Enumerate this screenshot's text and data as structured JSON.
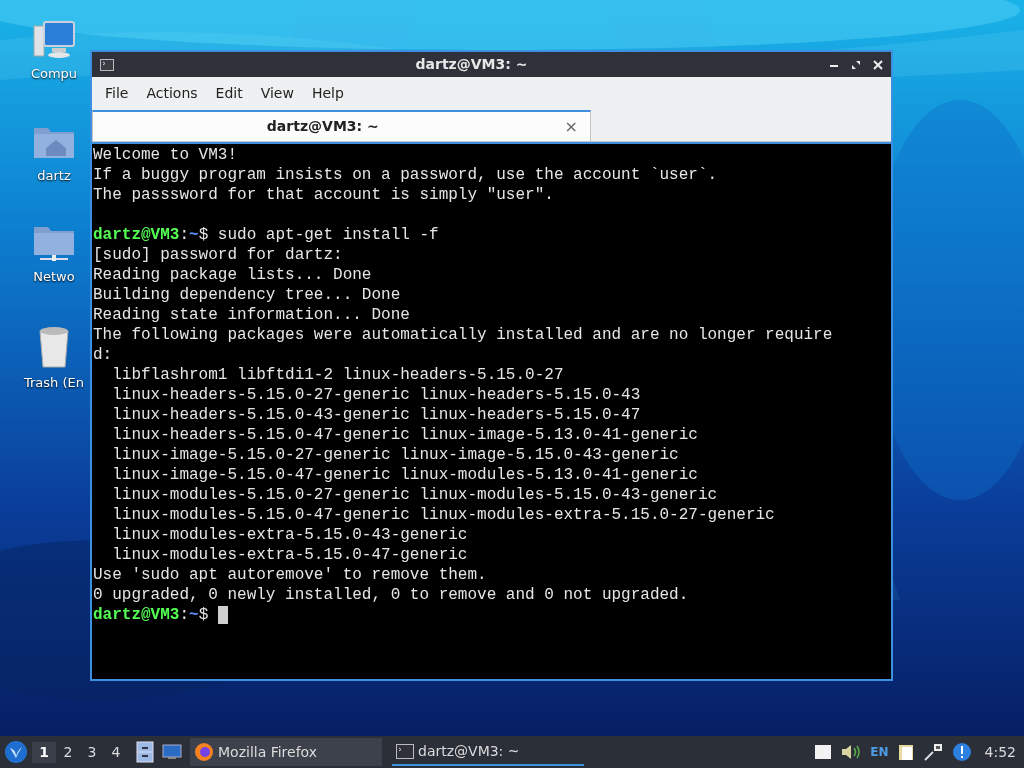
{
  "desktop_icons": [
    {
      "kind": "computer",
      "label": "Compu"
    },
    {
      "kind": "home",
      "label": "dartz"
    },
    {
      "kind": "network",
      "label": "Netwo"
    },
    {
      "kind": "trash",
      "label": "Trash (En"
    }
  ],
  "window": {
    "title": "dartz@VM3: ~",
    "menu": [
      "File",
      "Actions",
      "Edit",
      "View",
      "Help"
    ],
    "tabs": [
      {
        "label": "dartz@VM3: ~",
        "selected": true,
        "close": "×"
      }
    ],
    "terminal_lines": [
      {
        "kind": "text",
        "text": "Welcome to VM3!"
      },
      {
        "kind": "text",
        "text": "If a buggy program insists on a password, use the account `user`."
      },
      {
        "kind": "text",
        "text": "The passsword for that account is simply \"user\"."
      },
      {
        "kind": "blank"
      },
      {
        "kind": "prompt",
        "user_host": "dartz@VM3",
        "separator": ":",
        "path": "~",
        "sign": "$",
        "command": "sudo apt-get install -f"
      },
      {
        "kind": "text",
        "text": "[sudo] password for dartz:"
      },
      {
        "kind": "text",
        "text": "Reading package lists... Done"
      },
      {
        "kind": "text",
        "text": "Building dependency tree... Done"
      },
      {
        "kind": "text",
        "text": "Reading state information... Done"
      },
      {
        "kind": "text",
        "text": "The following packages were automatically installed and are no longer require"
      },
      {
        "kind": "text",
        "text": "d:"
      },
      {
        "kind": "text",
        "text": "  libflashrom1 libftdi1-2 linux-headers-5.15.0-27"
      },
      {
        "kind": "text",
        "text": "  linux-headers-5.15.0-27-generic linux-headers-5.15.0-43"
      },
      {
        "kind": "text",
        "text": "  linux-headers-5.15.0-43-generic linux-headers-5.15.0-47"
      },
      {
        "kind": "text",
        "text": "  linux-headers-5.15.0-47-generic linux-image-5.13.0-41-generic"
      },
      {
        "kind": "text",
        "text": "  linux-image-5.15.0-27-generic linux-image-5.15.0-43-generic"
      },
      {
        "kind": "text",
        "text": "  linux-image-5.15.0-47-generic linux-modules-5.13.0-41-generic"
      },
      {
        "kind": "text",
        "text": "  linux-modules-5.15.0-27-generic linux-modules-5.15.0-43-generic"
      },
      {
        "kind": "text",
        "text": "  linux-modules-5.15.0-47-generic linux-modules-extra-5.15.0-27-generic"
      },
      {
        "kind": "text",
        "text": "  linux-modules-extra-5.15.0-43-generic"
      },
      {
        "kind": "text",
        "text": "  linux-modules-extra-5.15.0-47-generic"
      },
      {
        "kind": "text",
        "text": "Use 'sudo apt autoremove' to remove them."
      },
      {
        "kind": "text",
        "text": "0 upgraded, 0 newly installed, 0 to remove and 0 not upgraded."
      },
      {
        "kind": "prompt",
        "user_host": "dartz@VM3",
        "separator": ":",
        "path": "~",
        "sign": "$",
        "cursor": true
      }
    ]
  },
  "taskbar": {
    "workspaces": [
      {
        "label": "1",
        "selected": true
      },
      {
        "label": "2",
        "selected": false
      },
      {
        "label": "3",
        "selected": false
      },
      {
        "label": "4",
        "selected": false
      }
    ],
    "tasks": [
      {
        "kind": "firefox",
        "label": "Mozilla Firefox",
        "selected": false
      },
      {
        "kind": "terminal",
        "label": "dartz@VM3: ~",
        "selected": true
      }
    ],
    "keyboard_layout": "EN",
    "clock": "4:52"
  }
}
